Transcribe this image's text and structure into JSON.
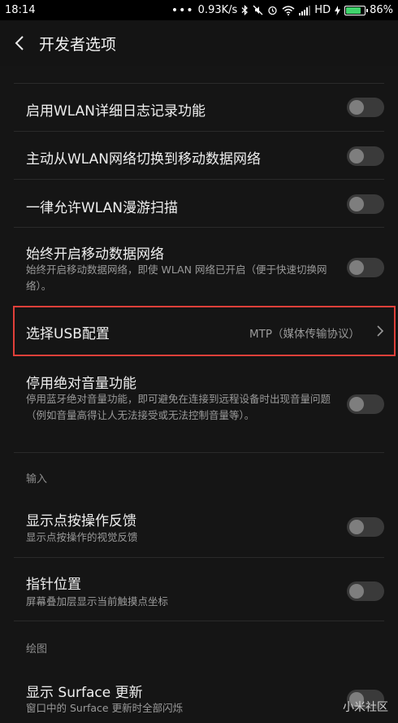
{
  "status_bar": {
    "time": "18:14",
    "speed": "0.93K/s",
    "network": "HD",
    "battery_percent": "86%",
    "battery_level": 0.86
  },
  "header": {
    "title": "开发者选项"
  },
  "rows": {
    "wlan_log": {
      "title": "启用WLAN详细日志记录功能",
      "enabled": false
    },
    "wlan_switch": {
      "title": "主动从WLAN网络切换到移动数据网络",
      "enabled": false
    },
    "wlan_roam": {
      "title": "一律允许WLAN漫游扫描",
      "enabled": false
    },
    "mobile_data": {
      "title": "始终开启移动数据网络",
      "subtitle": "始终开启移动数据网络，即使 WLAN 网络已开启（便于快速切换网络）。",
      "enabled": false
    },
    "usb_config": {
      "title": "选择USB配置",
      "value": "MTP（媒体传输协议）"
    },
    "abs_volume": {
      "title": "停用绝对音量功能",
      "subtitle": "停用蓝牙绝对音量功能，即可避免在连接到远程设备时出现音量问题（例如音量高得让人无法接受或无法控制音量等）。",
      "enabled": false
    },
    "show_taps": {
      "title": "显示点按操作反馈",
      "subtitle": "显示点按操作的视觉反馈",
      "enabled": false
    },
    "pointer": {
      "title": "指针位置",
      "subtitle": "屏幕叠加层显示当前触摸点坐标",
      "enabled": false
    },
    "surface": {
      "title": "显示 Surface 更新",
      "subtitle": "窗口中的 Surface 更新时全部闪烁",
      "enabled": false
    }
  },
  "sections": {
    "input": "输入",
    "drawing": "绘图"
  },
  "watermark": "小米社区",
  "colors": {
    "highlight": "#e0403a",
    "background": "#151515",
    "appbar": "#141414"
  }
}
